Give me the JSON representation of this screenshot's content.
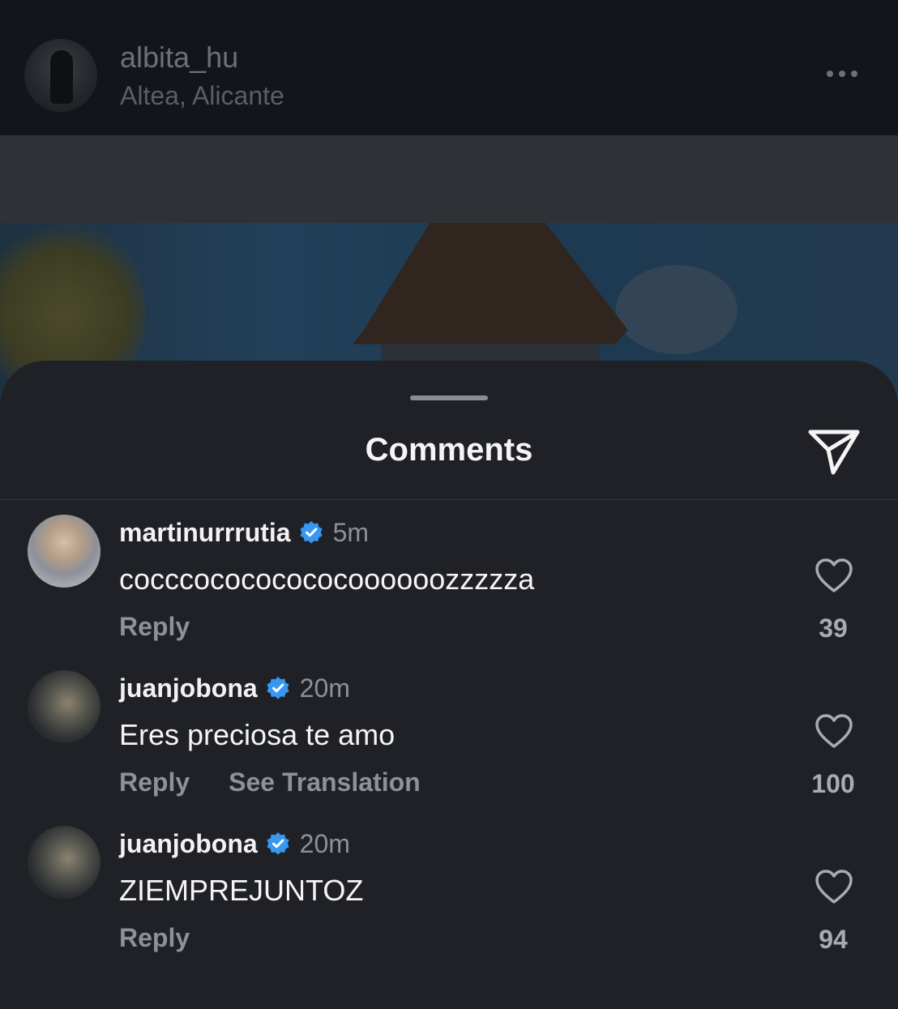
{
  "post": {
    "username": "albita_hu",
    "location": "Altea, Alicante"
  },
  "sheet": {
    "title": "Comments"
  },
  "comments": [
    {
      "username": "martinurrrutia",
      "time": "5m",
      "text": "cocccocococococoooooozzzzza",
      "reply": "Reply",
      "likes": "39"
    },
    {
      "username": "juanjobona",
      "time": "20m",
      "text": "Eres preciosa te amo",
      "reply": "Reply",
      "translate": "See Translation",
      "likes": "100"
    },
    {
      "username": "juanjobona",
      "time": "20m",
      "text": "ZIEMPREJUNTOZ",
      "reply": "Reply",
      "likes": "94"
    }
  ],
  "colors": {
    "verified": "#3897f0",
    "sheet_bg": "#1f2126",
    "muted_text": "#8e9196"
  },
  "icons": [
    "more-icon",
    "share-icon",
    "verified-icon",
    "heart-icon"
  ]
}
